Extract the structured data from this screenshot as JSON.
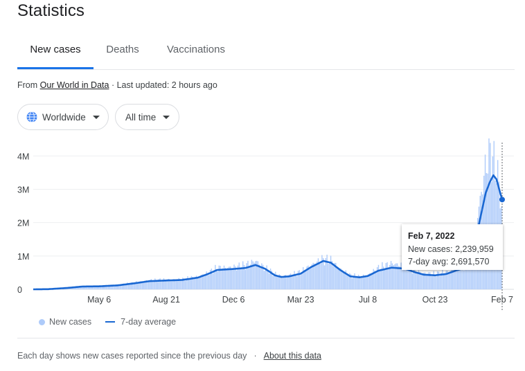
{
  "page": {
    "title": "Statistics"
  },
  "tabs": [
    {
      "label": "New cases",
      "active": true
    },
    {
      "label": "Deaths",
      "active": false
    },
    {
      "label": "Vaccinations",
      "active": false
    }
  ],
  "source": {
    "prefix": "From",
    "link": "Our World in Data",
    "updated": " · Last updated: 2 hours ago"
  },
  "filters": {
    "region": {
      "label": "Worldwide",
      "icon": "globe-icon"
    },
    "range": {
      "label": "All time"
    }
  },
  "legend": {
    "new_cases": "New cases",
    "avg": "7-day average"
  },
  "tooltip": {
    "date": "Feb 7, 2022",
    "new_cases": "New cases: 2,239,959",
    "avg": "7-day avg: 2,691,570"
  },
  "footer": {
    "note": "Each day shows new cases reported since the previous day",
    "separator": "·",
    "link": "About this data"
  },
  "colors": {
    "bar": "#aecbfa",
    "line": "#1967d2",
    "accent": "#1a73e8"
  },
  "chart_data": {
    "type": "area",
    "title": "",
    "xlabel": "",
    "ylabel": "",
    "ylim": [
      0,
      4400000
    ],
    "y_ticks": [
      {
        "value": 0,
        "label": "0"
      },
      {
        "value": 1000000,
        "label": "1M"
      },
      {
        "value": 2000000,
        "label": "2M"
      },
      {
        "value": 3000000,
        "label": "3M"
      },
      {
        "value": 4000000,
        "label": "4M"
      }
    ],
    "x_range": [
      "2020-01-22",
      "2022-02-07"
    ],
    "x_ticks": [
      {
        "date": "2020-05-06",
        "label": "May 6"
      },
      {
        "date": "2020-08-21",
        "label": "Aug 21"
      },
      {
        "date": "2020-12-06",
        "label": "Dec 6"
      },
      {
        "date": "2021-03-23",
        "label": "Mar 23"
      },
      {
        "date": "2021-07-08",
        "label": "Jul 8"
      },
      {
        "date": "2021-10-23",
        "label": "Oct 23"
      },
      {
        "date": "2022-02-07",
        "label": "Feb 7"
      }
    ],
    "series": [
      {
        "name": "7-day average",
        "points": [
          [
            "2020-01-22",
            0
          ],
          [
            "2020-02-15",
            5000
          ],
          [
            "2020-03-15",
            40000
          ],
          [
            "2020-04-10",
            85000
          ],
          [
            "2020-05-06",
            90000
          ],
          [
            "2020-06-05",
            120000
          ],
          [
            "2020-07-01",
            180000
          ],
          [
            "2020-07-25",
            245000
          ],
          [
            "2020-08-21",
            265000
          ],
          [
            "2020-09-15",
            280000
          ],
          [
            "2020-10-10",
            350000
          ],
          [
            "2020-10-25",
            450000
          ],
          [
            "2020-11-10",
            580000
          ],
          [
            "2020-12-06",
            610000
          ],
          [
            "2020-12-25",
            640000
          ],
          [
            "2021-01-10",
            730000
          ],
          [
            "2021-01-25",
            620000
          ],
          [
            "2021-02-10",
            420000
          ],
          [
            "2021-02-20",
            370000
          ],
          [
            "2021-03-05",
            390000
          ],
          [
            "2021-03-23",
            470000
          ],
          [
            "2021-04-08",
            660000
          ],
          [
            "2021-04-28",
            850000
          ],
          [
            "2021-05-10",
            800000
          ],
          [
            "2021-05-25",
            580000
          ],
          [
            "2021-06-10",
            390000
          ],
          [
            "2021-06-25",
            360000
          ],
          [
            "2021-07-08",
            400000
          ],
          [
            "2021-07-25",
            560000
          ],
          [
            "2021-08-15",
            650000
          ],
          [
            "2021-09-05",
            620000
          ],
          [
            "2021-09-20",
            520000
          ],
          [
            "2021-10-05",
            440000
          ],
          [
            "2021-10-23",
            420000
          ],
          [
            "2021-11-10",
            460000
          ],
          [
            "2021-11-25",
            560000
          ],
          [
            "2021-12-10",
            650000
          ],
          [
            "2021-12-20",
            900000
          ],
          [
            "2021-12-28",
            1600000
          ],
          [
            "2022-01-05",
            2300000
          ],
          [
            "2022-01-12",
            2900000
          ],
          [
            "2022-01-18",
            3200000
          ],
          [
            "2022-01-24",
            3420000
          ],
          [
            "2022-01-29",
            3300000
          ],
          [
            "2022-02-03",
            2950000
          ],
          [
            "2022-02-07",
            2691570
          ]
        ]
      },
      {
        "name": "New cases",
        "points": [
          [
            "2020-01-22",
            0
          ],
          [
            "2020-02-15",
            6000
          ],
          [
            "2020-03-15",
            50000
          ],
          [
            "2020-04-10",
            95000
          ],
          [
            "2020-05-06",
            100000
          ],
          [
            "2020-06-05",
            135000
          ],
          [
            "2020-07-01",
            200000
          ],
          [
            "2020-07-25",
            270000
          ],
          [
            "2020-08-21",
            290000
          ],
          [
            "2020-09-15",
            300000
          ],
          [
            "2020-10-10",
            380000
          ],
          [
            "2020-10-25",
            480000
          ],
          [
            "2020-11-10",
            640000
          ],
          [
            "2020-12-06",
            660000
          ],
          [
            "2020-12-25",
            720000
          ],
          [
            "2021-01-10",
            860000
          ],
          [
            "2021-01-25",
            640000
          ],
          [
            "2021-02-10",
            460000
          ],
          [
            "2021-02-20",
            400000
          ],
          [
            "2021-03-05",
            420000
          ],
          [
            "2021-03-23",
            520000
          ],
          [
            "2021-04-08",
            720000
          ],
          [
            "2021-04-28",
            900000
          ],
          [
            "2021-05-10",
            870000
          ],
          [
            "2021-05-25",
            610000
          ],
          [
            "2021-06-10",
            420000
          ],
          [
            "2021-06-25",
            380000
          ],
          [
            "2021-07-08",
            430000
          ],
          [
            "2021-07-25",
            640000
          ],
          [
            "2021-08-15",
            780000
          ],
          [
            "2021-09-05",
            700000
          ],
          [
            "2021-09-20",
            560000
          ],
          [
            "2021-10-05",
            480000
          ],
          [
            "2021-10-23",
            460000
          ],
          [
            "2021-11-10",
            520000
          ],
          [
            "2021-11-25",
            620000
          ],
          [
            "2021-12-10",
            720000
          ],
          [
            "2021-12-20",
            1100000
          ],
          [
            "2021-12-28",
            2000000
          ],
          [
            "2022-01-05",
            2900000
          ],
          [
            "2022-01-12",
            3700000
          ],
          [
            "2022-01-18",
            4200000
          ],
          [
            "2022-01-24",
            3800000
          ],
          [
            "2022-01-29",
            3600000
          ],
          [
            "2022-02-03",
            3000000
          ],
          [
            "2022-02-07",
            2239959
          ]
        ]
      }
    ],
    "highlight": {
      "date": "2022-02-07",
      "value": 2691570
    },
    "grid": true,
    "legend": "bottom-left"
  }
}
